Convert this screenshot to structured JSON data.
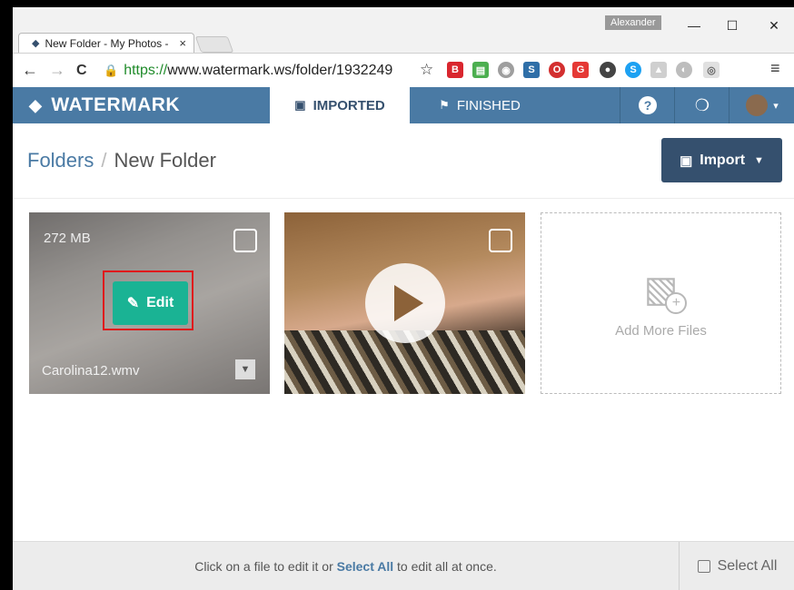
{
  "browser": {
    "tab_title": "New Folder - My Photos -",
    "tab_close": "×",
    "user_badge": "Alexander",
    "win_minimize": "—",
    "win_maximize": "☐",
    "win_close": "✕",
    "back": "←",
    "forward": "→",
    "reload": "C",
    "url_scheme": "https://",
    "url_rest": "www.watermark.ws/folder/1932249",
    "star": "☆",
    "menu": "≡"
  },
  "app": {
    "brand": "WATERMARK",
    "tabs": [
      {
        "label": "IMPORTED",
        "icon": "images-icon"
      },
      {
        "label": "FINISHED",
        "icon": "flag-icon"
      }
    ],
    "help_icon": "?",
    "chat_icon": "💬",
    "avatar_caret": "▾"
  },
  "page": {
    "breadcrumb_root": "Folders",
    "breadcrumb_sep": "/",
    "breadcrumb_current": "New Folder",
    "import_label": "Import",
    "files": [
      {
        "size": "272 MB",
        "name": "Carolina12.wmv",
        "edit_label": "Edit"
      },
      {
        "type": "video"
      }
    ],
    "add_more": "Add More Files"
  },
  "footer": {
    "msg_prefix": "Click on a file to edit it or ",
    "msg_link": "Select All",
    "msg_suffix": " to edit all at once.",
    "select_all": "Select All"
  },
  "colors": {
    "navbar": "#4a7aa4",
    "primary_dark": "#35506e",
    "edit_green": "#1ab394",
    "highlight_red": "#e0191c"
  }
}
